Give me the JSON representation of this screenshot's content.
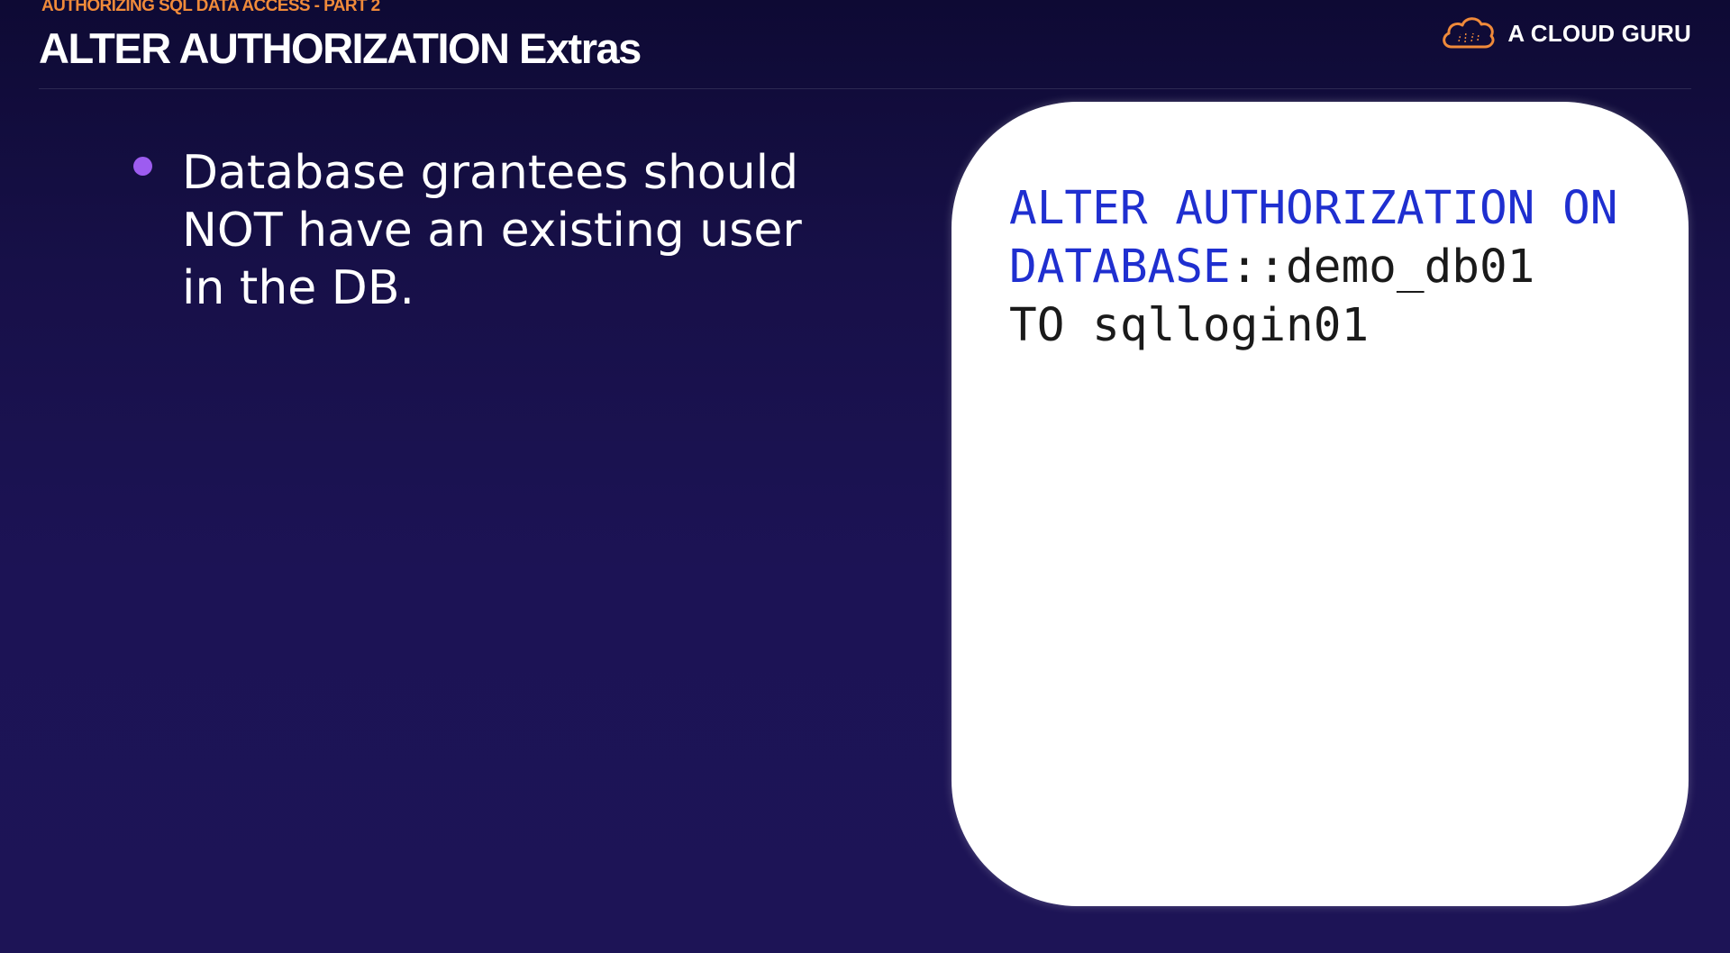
{
  "header": {
    "eyebrow": "AUTHORIZING SQL DATA ACCESS - PART 2",
    "title": "ALTER AUTHORIZATION Extras"
  },
  "brand": {
    "name": "A CLOUD GURU",
    "logo_icon": "cloud-icon"
  },
  "bullets": [
    {
      "text": "Database grantees should NOT have an existing user in the DB."
    }
  ],
  "code": {
    "line1_keyword": "ALTER AUTHORIZATION ON",
    "line2_keyword": "DATABASE",
    "line2_rest": "::demo_db01",
    "line3": "TO sqllogin01"
  },
  "colors": {
    "eyebrow": "#f08a3a",
    "bullet": "#9d5cf0",
    "sql_keyword": "#1f2fd0",
    "background": "#1c1355"
  }
}
